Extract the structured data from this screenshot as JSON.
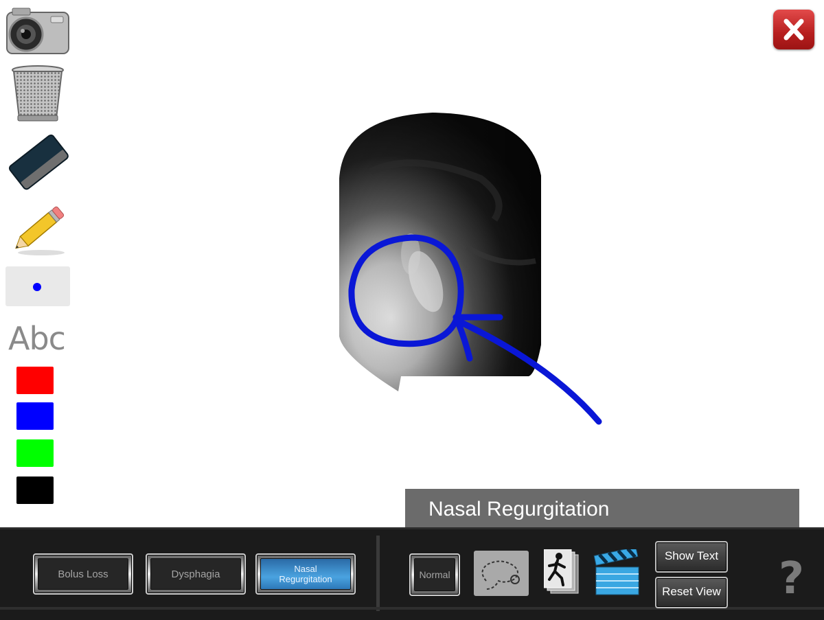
{
  "toolbar": {
    "abc_label": "Abc",
    "brush_color": "#0000ff",
    "colors": [
      "#ff0000",
      "#0000ff",
      "#00ff00",
      "#000000"
    ],
    "icons": [
      "camera-icon",
      "trash-icon",
      "eraser-icon",
      "pencil-icon"
    ]
  },
  "caption": {
    "text": "Nasal Regurgitation"
  },
  "bottom": {
    "buttons": [
      "Bolus Loss",
      "Dysphagia",
      "Nasal Regurgitation"
    ],
    "active": "Nasal Regurgitation",
    "normal_label": "Normal",
    "show_text_label": "Show Text",
    "reset_view_label": "Reset View",
    "help_label": "?"
  },
  "annotation_color": "#0a17d6"
}
